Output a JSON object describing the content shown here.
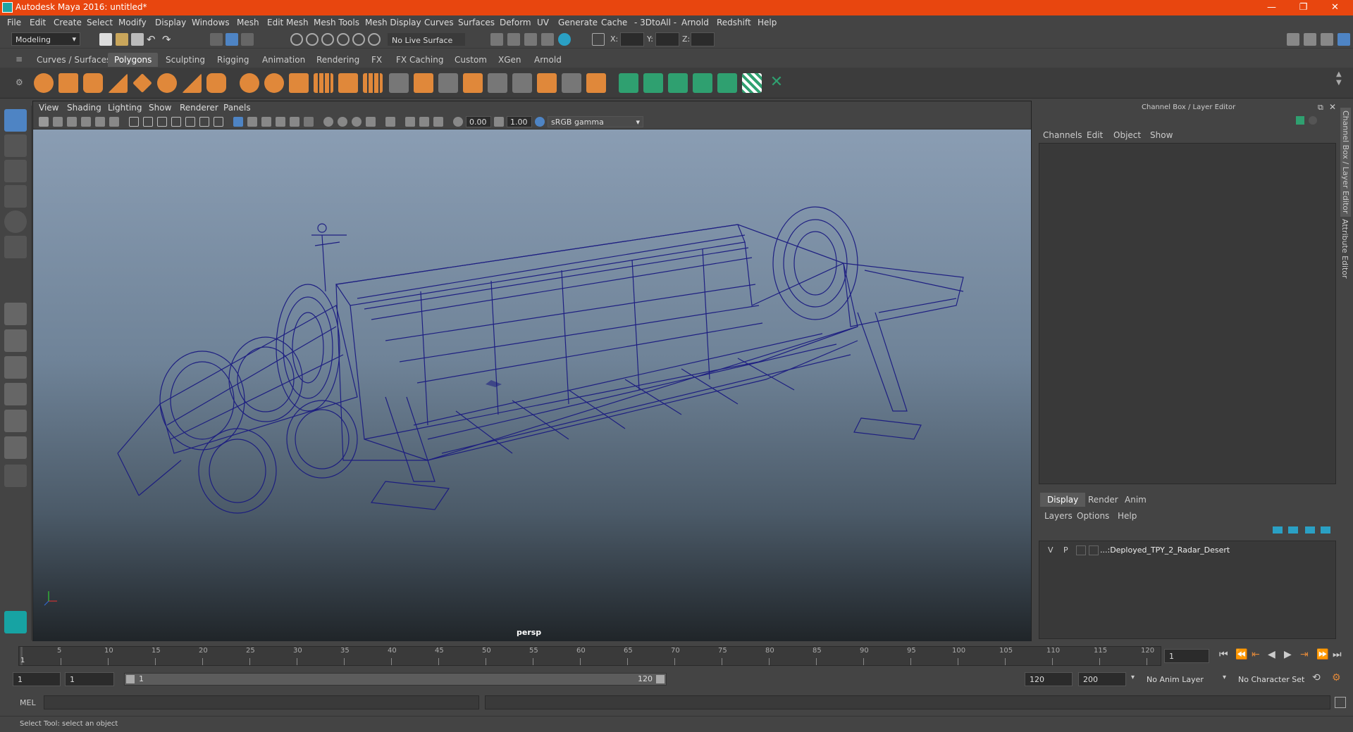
{
  "titlebar": {
    "title": "Autodesk Maya 2016: untitled*",
    "minimize": "—",
    "restore": "❐",
    "close": "✕"
  },
  "menu": [
    "File",
    "Edit",
    "Create",
    "Select",
    "Modify",
    "Display",
    "Windows",
    "Mesh",
    "Edit Mesh",
    "Mesh Tools",
    "Mesh Display",
    "Curves",
    "Surfaces",
    "Deform",
    "UV",
    "Generate",
    "Cache",
    "- 3DtoAll -",
    "Arnold",
    "Redshift",
    "Help"
  ],
  "statusline": {
    "mode": "Modeling",
    "live_surface": "No Live Surface",
    "x_label": "X:",
    "y_label": "Y:",
    "z_label": "Z:"
  },
  "shelf_tabs": [
    "Curves / Surfaces",
    "Polygons",
    "Sculpting",
    "Rigging",
    "Animation",
    "Rendering",
    "FX",
    "FX Caching",
    "Custom",
    "XGen",
    "Arnold"
  ],
  "shelf_active": "Polygons",
  "viewport": {
    "menu": [
      "View",
      "Shading",
      "Lighting",
      "Show",
      "Renderer",
      "Panels"
    ],
    "exposure": "0.00",
    "gamma": "1.00",
    "color_space": "sRGB gamma",
    "camera_label": "persp"
  },
  "channel_box": {
    "header": "Channel Box / Layer Editor",
    "menu": [
      "Channels",
      "Edit",
      "Object",
      "Show"
    ]
  },
  "layer_editor": {
    "tabs": [
      "Display",
      "Render",
      "Anim"
    ],
    "menu": [
      "Layers",
      "Options",
      "Help"
    ],
    "layers": [
      {
        "v": "V",
        "p": "P",
        "name": "...:Deployed_TPY_2_Radar_Desert"
      }
    ]
  },
  "side_tabs": {
    "channel": "Channel Box / Layer Editor",
    "attribute": "Attribute Editor"
  },
  "timeline": {
    "ticks": [
      "5",
      "10",
      "15",
      "20",
      "25",
      "30",
      "35",
      "40",
      "45",
      "50",
      "55",
      "60",
      "65",
      "70",
      "75",
      "80",
      "85",
      "90",
      "95",
      "100",
      "105",
      "110",
      "115",
      "120"
    ],
    "start_marker": "1",
    "current_frame": "1"
  },
  "range": {
    "start": "1",
    "anim_start": "1",
    "slider_start": "1",
    "slider_end": "120",
    "anim_end": "120",
    "end": "200",
    "anim_layer": "No Anim Layer",
    "character_set": "No Character Set"
  },
  "cmdline": {
    "label": "MEL"
  },
  "helpline": {
    "text": "Select Tool: select an object"
  },
  "colors": {
    "accent": "#e8460f",
    "wire": "#1a1a80",
    "active_tab": "#5a5a5a"
  }
}
